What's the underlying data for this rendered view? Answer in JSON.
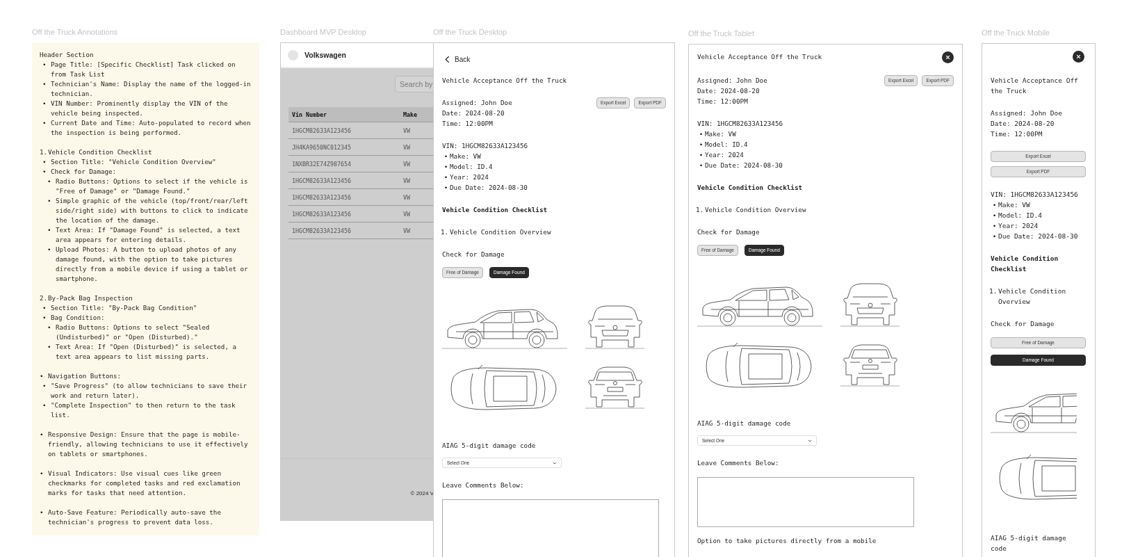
{
  "annotations": {
    "label": "Off the Truck Annotations",
    "items": [
      {
        "text": "Header Section",
        "children": [
          {
            "marker": "•",
            "text": "Page Title: [Specific Checklist] Task clicked on from Task List"
          },
          {
            "marker": "•",
            "text": "Technician's Name: Display the name of the logged-in technician."
          },
          {
            "marker": "•",
            "text": "VIN Number: Prominently display the VIN of the vehicle being inspected."
          },
          {
            "marker": "•",
            "text": "Current Date and Time: Auto-populated to record when the inspection is being performed."
          }
        ]
      },
      {
        "marker": "1.",
        "text": "Vehicle Condition Checklist",
        "children": [
          {
            "marker": "•",
            "text": "Section Title: \"Vehicle Condition Overview\""
          },
          {
            "marker": "•",
            "text": "Check for Damage:",
            "children": [
              {
                "marker": "•",
                "text": "Radio Buttons: Options to select if the vehicle is \"Free of Damage\" or \"Damage Found.\""
              },
              {
                "marker": "•",
                "text": "Simple graphic of the vehicle (top/front/rear/left side/right side) with buttons to click to indicate the location of the damage."
              },
              {
                "marker": "•",
                "text": "Text Area: If \"Damage Found\" is selected, a text area appears for entering details."
              },
              {
                "marker": "•",
                "text": "Upload Photos: A button to upload photos of any damage found, with the option to take pictures directly from a mobile device if using a tablet or smartphone."
              }
            ]
          }
        ]
      },
      {
        "marker": "2.",
        "text": "By-Pack Bag Inspection",
        "children": [
          {
            "marker": "•",
            "text": "Section Title: \"By-Pack Bag Condition\""
          },
          {
            "marker": "•",
            "text": "Bag Condition:",
            "children": [
              {
                "marker": "•",
                "text": "Radio Buttons: Options to select \"Sealed (Undisturbed)\" or \"Open (Disturbed).\""
              },
              {
                "marker": "•",
                "text": "Text Area: If \"Open (Disturbed)\" is selected, a text area appears to list missing parts."
              }
            ]
          }
        ]
      },
      {
        "marker": "•",
        "text": "Navigation Buttons:",
        "children": [
          {
            "marker": "•",
            "text": "\"Save Progress\" (to allow technicians to save their work and return later)."
          },
          {
            "marker": "•",
            "text": "\"Complete Inspection\" to then return to the task list."
          }
        ]
      },
      {
        "marker": "•",
        "text": "Responsive Design: Ensure that the page is mobile-friendly, allowing technicians to use it effectively on tablets or smartphones."
      },
      {
        "marker": "•",
        "text": "Visual Indicators: Use visual cues like green checkmarks for completed tasks and red exclamation marks for tasks that need attention."
      },
      {
        "marker": "•",
        "text": "Auto-Save Feature: Periodically auto-save the technician's progress to prevent data loss."
      }
    ]
  },
  "dashboard": {
    "label": "Dashboard MVP Desktop",
    "brand": "Volkswagen",
    "search": {
      "placeholder": "Search by"
    },
    "columns": [
      "Vin Number",
      "Make"
    ],
    "rows": [
      [
        "1HGCM82633A123456",
        "VW"
      ],
      [
        "JH4KA9650NC012345",
        "VW"
      ],
      [
        "1NXBR32E74Z987654",
        "VW"
      ],
      [
        "1HGCM82633A123456",
        "VW"
      ],
      [
        "1HGCM82633A123456",
        "VW"
      ],
      [
        "1HGCM82633A123456",
        "VW"
      ],
      [
        "1HGCM82633A123456",
        "VW"
      ]
    ],
    "footer": "© 2024 V"
  },
  "screens": [
    {
      "kind": "desktop",
      "label": "Off the Truck Desktop",
      "back": "Back",
      "close_button": false,
      "title": "Vehicle Acceptance Off the Truck",
      "info": [
        "Assigned: John Doe",
        "Date: 2024-08-20",
        "Time: 12:00PM"
      ],
      "exports": [
        "Export Excel",
        "Export PDF"
      ],
      "vin": "VIN: 1HGCM82633A123456",
      "details": [
        {
          "marker": "•",
          "text": "Make: VW"
        },
        {
          "marker": "•",
          "text": "Model: ID.4"
        },
        {
          "marker": "•",
          "text": "Year: 2024"
        },
        {
          "marker": "•",
          "text": "Due Date: 2024-08-30"
        }
      ],
      "checklist_title": "Vehicle Condition Checklist",
      "section": {
        "marker": "1.",
        "text": "Vehicle Condition Overview"
      },
      "damage_label": "Check for Damage",
      "damage_options": [
        {
          "label": "Free of Damage",
          "selected": false
        },
        {
          "label": "Damage Found",
          "selected": true
        }
      ],
      "code_label": "AIAG 5-digit damage code",
      "code_select": "Select One",
      "comments_label": "Leave Comments Below:"
    },
    {
      "kind": "tablet",
      "label": "Off the Truck Tablet",
      "close_button": true,
      "title": "Vehicle Acceptance Off the Truck",
      "info": [
        "Assigned: John Doe",
        "Date: 2024-08-20",
        "Time: 12:00PM"
      ],
      "exports": [
        "Export Excel",
        "Export PDF"
      ],
      "vin": "VIN: 1HGCM82633A123456",
      "details": [
        {
          "marker": "•",
          "text": "Make: VW"
        },
        {
          "marker": "•",
          "text": "Model: ID.4"
        },
        {
          "marker": "•",
          "text": "Year: 2024"
        },
        {
          "marker": "•",
          "text": "Due Date: 2024-08-30"
        }
      ],
      "checklist_title": "Vehicle Condition Checklist",
      "section": {
        "marker": "1.",
        "text": "Vehicle Condition Overview"
      },
      "damage_label": "Check for Damage",
      "damage_options": [
        {
          "label": "Free of Damage",
          "selected": false
        },
        {
          "label": "Damage Found",
          "selected": true
        }
      ],
      "code_label": "AIAG 5-digit damage code",
      "code_select": "Select One",
      "comments_label": "Leave Comments Below:",
      "photo_note": "Option to take pictures directly from a mobile"
    },
    {
      "kind": "mobile",
      "label": "Off the Truck Mobile",
      "close_button": true,
      "title": "Vehicle Acceptance Off the Truck",
      "info": [
        "Assigned: John Doe",
        "Date: 2024-08-20",
        "Time: 12:00PM"
      ],
      "exports": [
        "Export Excel",
        "Export PDF"
      ],
      "vin": "VIN: 1HGCM82633A123456",
      "details": [
        {
          "marker": "•",
          "text": "Make: VW"
        },
        {
          "marker": "•",
          "text": "Model: ID.4"
        },
        {
          "marker": "•",
          "text": "Year: 2024"
        },
        {
          "marker": "•",
          "text": "Due Date: 2024-08-30"
        }
      ],
      "checklist_title": "Vehicle Condition Checklist",
      "section": {
        "marker": "1.",
        "text": "Vehicle Condition Overview"
      },
      "damage_label": "Check for Damage",
      "damage_options": [
        {
          "label": "Free of Damage",
          "selected": false
        },
        {
          "label": "Damage Found",
          "selected": true
        }
      ],
      "code_label": "AIAG 5-digit damage code"
    }
  ]
}
